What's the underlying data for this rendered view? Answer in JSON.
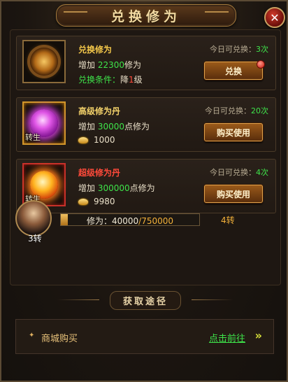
{
  "window": {
    "title": "兑换修为",
    "close_icon": "close-icon"
  },
  "cards": [
    {
      "name": "兑换修为",
      "name_color": "#f3c74a",
      "limit_label": "今日可兑换：",
      "limit_value": "3次",
      "gain_prefix": "增加",
      "gain_value": "22300",
      "gain_suffix": "修为",
      "cond_label": "兑换条件：",
      "cond_action": "降",
      "cond_value": "1",
      "cond_suffix": "级",
      "button": "兑换",
      "has_notice_dot": true
    },
    {
      "name": "高级修为丹",
      "name_color": "#f3d16a",
      "rebirth_tag": "转生",
      "limit_label": "今日可兑换：",
      "limit_value": "20次",
      "gain_prefix": "增加",
      "gain_value": "30000",
      "gain_suffix": "点修为",
      "cost": "1000",
      "button": "购买使用"
    },
    {
      "name": "超级修为丹",
      "name_color": "#ff4a3a",
      "rebirth_tag": "转生",
      "limit_label": "今日可兑换：",
      "limit_value": "4次",
      "gain_prefix": "增加",
      "gain_value": "300000",
      "gain_suffix": "点修为",
      "cost": "9980",
      "button": "购买使用"
    }
  ],
  "progress": {
    "avatar_level": "3转",
    "label": "修为：",
    "current": "40000",
    "goal": "/750000",
    "fraction": 0.053,
    "target_rebirth": "4转"
  },
  "sources": {
    "title": "获取途径",
    "items": [
      {
        "label": "商城购买",
        "link": "点击前往",
        "arrow": "»"
      }
    ]
  }
}
